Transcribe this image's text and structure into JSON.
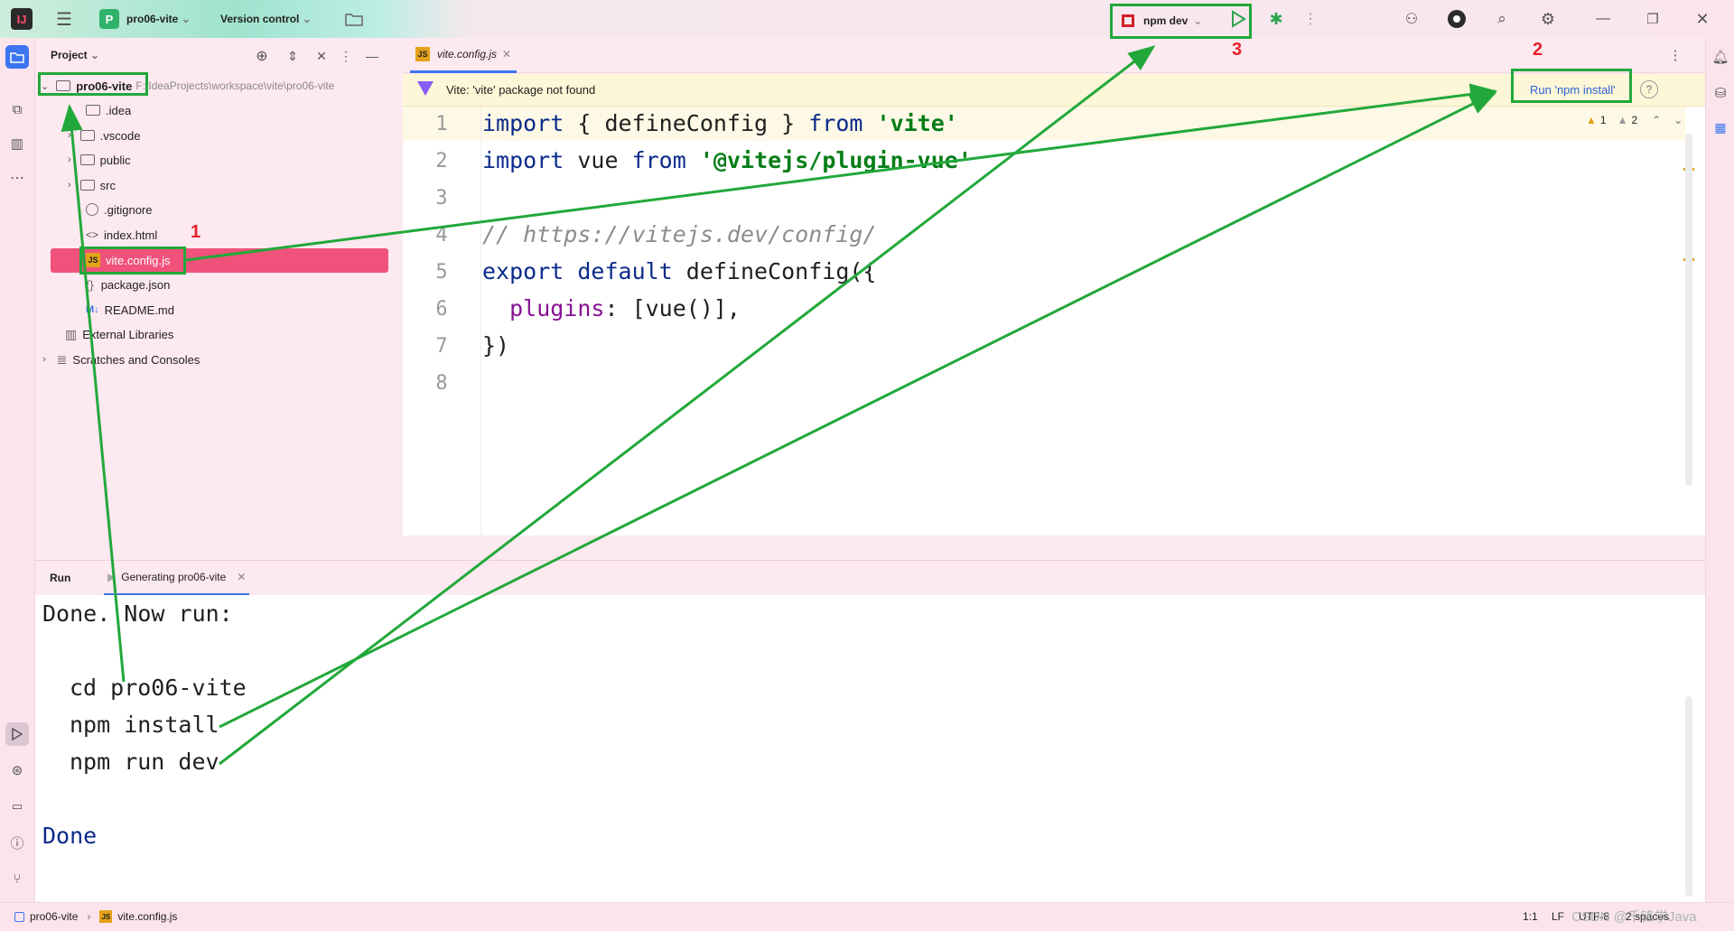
{
  "titlebar": {
    "project_badge": "P",
    "project_name": "pro06-vite",
    "vcs": "Version control",
    "run_config": "npm dev"
  },
  "project_panel": {
    "title": "Project",
    "root_name": "pro06-vite",
    "root_path": "F:\\IdeaProjects\\workspace\\vite\\pro06-vite",
    "items": [
      {
        "label": ".idea"
      },
      {
        "label": ".vscode"
      },
      {
        "label": "public"
      },
      {
        "label": "src"
      },
      {
        "label": ".gitignore"
      },
      {
        "label": "index.html"
      },
      {
        "label": "vite.config.js"
      },
      {
        "label": "package.json"
      },
      {
        "label": "README.md"
      },
      {
        "label": "External Libraries"
      },
      {
        "label": "Scratches and Consoles"
      }
    ]
  },
  "editor": {
    "tab": "vite.config.js",
    "banner_text": "Vite: 'vite' package not found",
    "banner_action": "Run 'npm install'",
    "warn_count": "1",
    "weak_warn_count": "2",
    "line_numbers": [
      "1",
      "2",
      "3",
      "4",
      "5",
      "6",
      "7",
      "8"
    ],
    "code": {
      "l1_kw": "import",
      "l1_mid": " { defineConfig } ",
      "l1_from": "from",
      "l1_str": "'vite'",
      "l2_kw": "import",
      "l2_mid": " vue ",
      "l2_from": "from",
      "l2_str": "'@vitejs/plugin-vue'",
      "l4_comment": "// https://vitejs.dev/config/",
      "l5_kw": "export default",
      "l5_rest": " defineConfig({",
      "l6_prop": "plugins",
      "l6_rest": ": [vue()],",
      "l7": "})"
    }
  },
  "run_panel": {
    "tab_run": "Run",
    "tab_task": "Generating pro06-vite",
    "lines": [
      "Done. Now run:",
      "cd pro06-vite",
      "npm install",
      "npm run dev",
      "Done"
    ]
  },
  "status": {
    "crumb_project": "pro06-vite",
    "crumb_file": "vite.config.js",
    "position": "1:1",
    "line_sep": "LF",
    "encoding": "UTF-8",
    "indent": "2 spaces",
    "watermark": "CSDN @千锋学Java"
  },
  "annotations": {
    "n1": "1",
    "n2": "2",
    "n3": "3"
  },
  "colors": {
    "accent": "#22a83a",
    "selection": "#f0527b",
    "marker": "#e5202a"
  }
}
